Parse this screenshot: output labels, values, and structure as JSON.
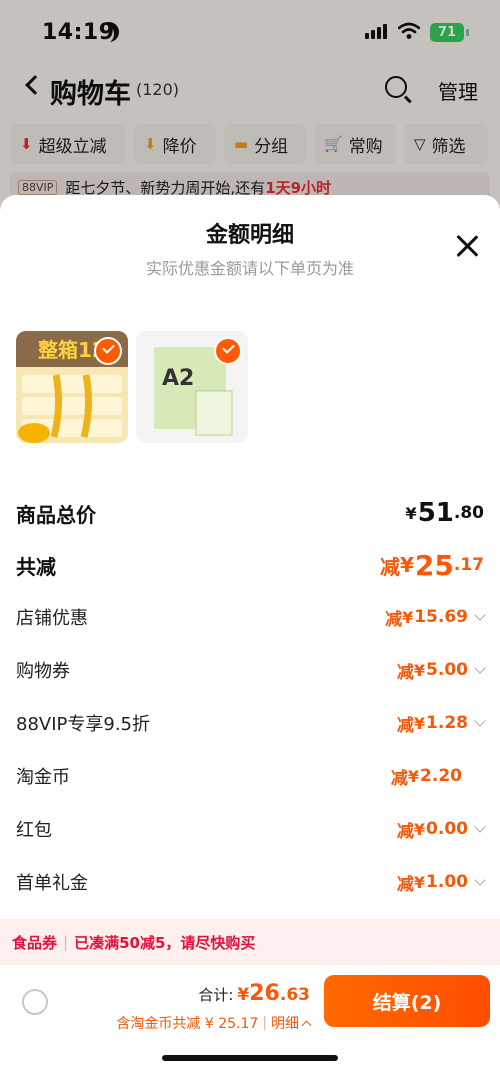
{
  "status_bar": {
    "time": "14:19",
    "battery": "71"
  },
  "cart": {
    "title": "购物车",
    "count": "(120)",
    "manage_label": "管理"
  },
  "filters": [
    {
      "label": "超级立减",
      "icon": "down-arrow-icon"
    },
    {
      "label": "降价",
      "icon": "down-arrow-icon"
    },
    {
      "label": "分组",
      "icon": "folder-icon"
    },
    {
      "label": "常购",
      "icon": "cart-icon"
    },
    {
      "label": "筛选",
      "icon": "filter-icon"
    }
  ],
  "banner": {
    "vip": "88VIP",
    "text": "距七夕节、新势力周开始,还有",
    "highlight": "1天9小时"
  },
  "sheet": {
    "title": "金额明细",
    "subtitle": "实际优惠金额请以下单页为准"
  },
  "products": [
    {
      "name_on_image": "整箱12",
      "checked": true,
      "color": "#f7e7b4"
    },
    {
      "name_on_image": "A2",
      "checked": true,
      "color": "#f4f4f4"
    }
  ],
  "breakdown": {
    "subtotal": {
      "label": "商品总价",
      "currency": "¥",
      "int": "51",
      "dec": ".80"
    },
    "total_reduce": {
      "label": "共减",
      "prefix": "减",
      "currency": "¥",
      "int": "25",
      "dec": ".17"
    },
    "items": [
      {
        "label": "店铺优惠",
        "prefix": "减",
        "currency": "¥",
        "int": "15",
        "dec": ".69",
        "expandable": true
      },
      {
        "label": "购物券",
        "prefix": "减",
        "currency": "¥",
        "int": "5",
        "dec": ".00",
        "expandable": true
      },
      {
        "label": "88VIP专享9.5折",
        "prefix": "减",
        "currency": "¥",
        "int": "1",
        "dec": ".28",
        "expandable": true
      },
      {
        "label": "淘金币",
        "prefix": "减",
        "currency": "¥",
        "int": "2",
        "dec": ".20",
        "expandable": false
      },
      {
        "label": "红包",
        "prefix": "减",
        "currency": "¥",
        "int": "0",
        "dec": ".00",
        "expandable": true
      },
      {
        "label": "首单礼金",
        "prefix": "减",
        "currency": "¥",
        "int": "1",
        "dec": ".00",
        "expandable": true
      }
    ]
  },
  "coupon_strip": {
    "tag": "食品券",
    "text": "已凑满50减5，请尽快购买"
  },
  "footer": {
    "total_label": "合计:",
    "total_currency": "¥",
    "total_int": "26",
    "total_dec": ".63",
    "discount_text": "含淘金币共减 ¥ 25.17",
    "detail_label": "明细",
    "checkout_label": "结算(2)"
  },
  "colors": {
    "accent": "#f5590b",
    "checkout": "#ff5a00",
    "coupon": "#e3113b"
  }
}
